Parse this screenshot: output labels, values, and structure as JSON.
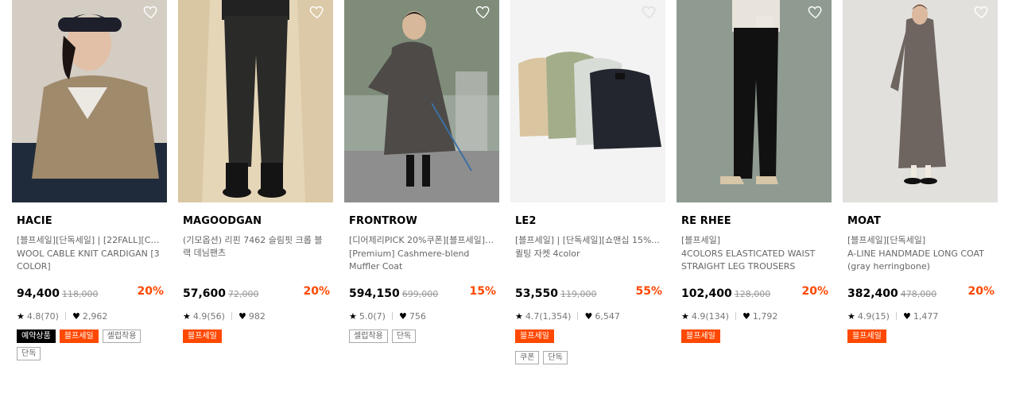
{
  "colors": {
    "accent": "#ff4800",
    "badge_black": "#000000"
  },
  "products": [
    {
      "brand": "HACIE",
      "tagline": "[블프세일][단독세일] | [22FALL][CH...",
      "name": "WOOL CABLE KNIT CARDIGAN [3 COLOR]",
      "price": "94,400",
      "original_price": "118,000",
      "discount": "20%",
      "rating": "4.8(70)",
      "likes": "2,962",
      "badges": [
        {
          "label": "예약상품",
          "style": "black"
        },
        {
          "label": "블프세일",
          "style": "orange"
        },
        {
          "label": "셀럽착용",
          "style": "outline"
        },
        {
          "label": "단독",
          "style": "outline"
        }
      ],
      "wishlist_icon": "heart-outline-icon"
    },
    {
      "brand": "MAGOODGAN",
      "tagline": "(기모옵션) 리핀 7462 슬림핏 크롭 블랙 데님팬츠",
      "name": "",
      "price": "57,600",
      "original_price": "72,000",
      "discount": "20%",
      "rating": "4.9(56)",
      "likes": "982",
      "badges": [
        {
          "label": "블프세일",
          "style": "orange"
        }
      ],
      "wishlist_icon": "heart-outline-icon"
    },
    {
      "brand": "FRONTROW",
      "tagline": "[디어제리PICK 20%쿠폰][블프세일] ...",
      "name": "[Premium] Cashmere-blend Muffler Coat",
      "price": "594,150",
      "original_price": "699,000",
      "discount": "15%",
      "rating": "5.0(7)",
      "likes": "756",
      "badges": [
        {
          "label": "셀럽착용",
          "style": "outline"
        },
        {
          "label": "단독",
          "style": "outline"
        }
      ],
      "wishlist_icon": "heart-outline-icon"
    },
    {
      "brand": "LE2",
      "tagline": "[블프세일] | [단독세일][쇼맨십 15%...",
      "name": "퀼팅 자켓 4color",
      "price": "53,550",
      "original_price": "119,000",
      "discount": "55%",
      "rating": "4.7(1,354)",
      "likes": "6,547",
      "badges": [
        {
          "label": "블프세일",
          "style": "orange"
        },
        {
          "label": "쿠폰",
          "style": "outline"
        },
        {
          "label": "단독",
          "style": "outline"
        }
      ],
      "wishlist_icon": "heart-outline-icon"
    },
    {
      "brand": "RE RHEE",
      "tagline": "[블프세일]",
      "name": "4COLORS ELASTICATED WAIST STRAIGHT LEG TROUSERS",
      "price": "102,400",
      "original_price": "128,000",
      "discount": "20%",
      "rating": "4.9(134)",
      "likes": "1,792",
      "badges": [
        {
          "label": "블프세일",
          "style": "orange"
        }
      ],
      "wishlist_icon": "heart-outline-icon"
    },
    {
      "brand": "MOAT",
      "tagline": "[블프세일][단독세일]",
      "name": "A-LINE HANDMADE LONG COAT (gray herringbone)",
      "price": "382,400",
      "original_price": "478,000",
      "discount": "20%",
      "rating": "4.9(15)",
      "likes": "1,477",
      "badges": [
        {
          "label": "블프세일",
          "style": "orange"
        }
      ],
      "wishlist_icon": "heart-outline-icon"
    }
  ]
}
